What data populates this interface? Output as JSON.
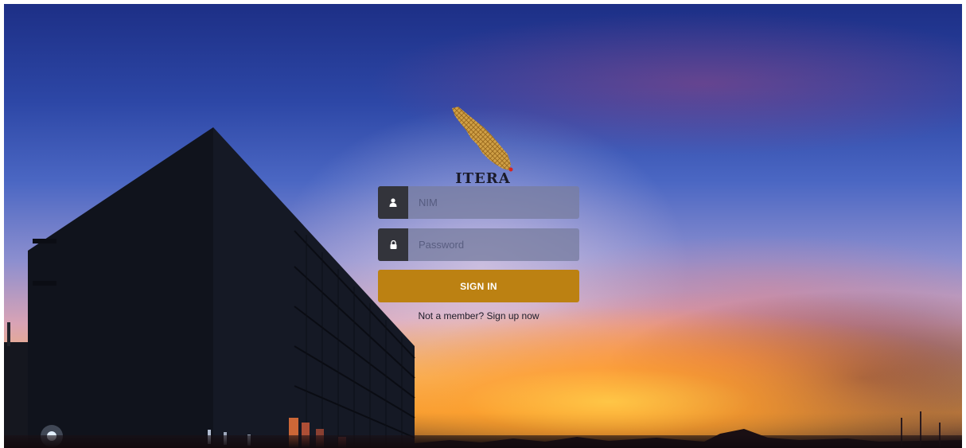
{
  "brand": {
    "name": "ITERA",
    "logo_icon": "itera-island-logo"
  },
  "login": {
    "username_icon": "user-icon",
    "username_placeholder": "NIM",
    "password_icon": "lock-icon",
    "password_placeholder": "Password",
    "submit_label": "SIGN IN",
    "signup_text": "Not a member? Sign up now"
  },
  "colors": {
    "accent": "#bc8112",
    "addon_bg": "#33343b",
    "input_bg": "#787da0"
  }
}
